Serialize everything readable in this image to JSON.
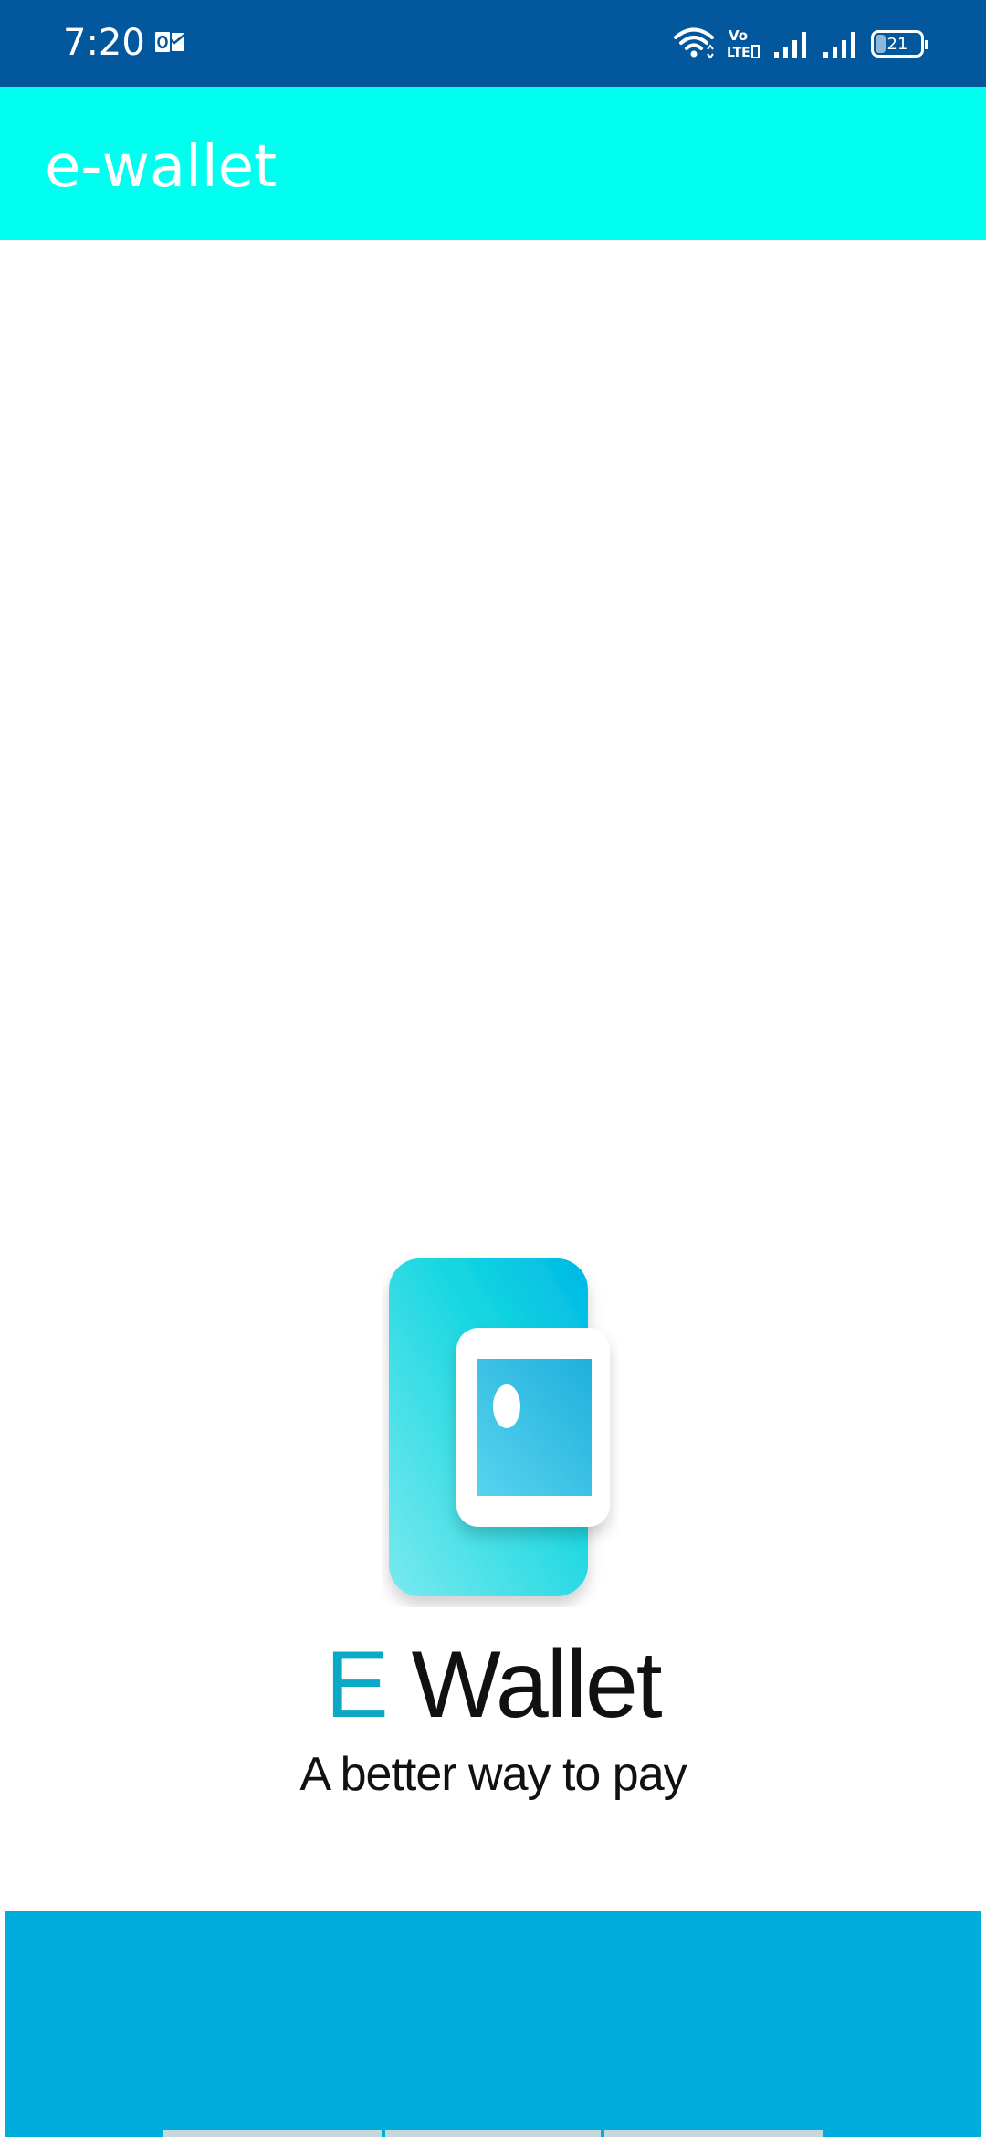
{
  "status_bar": {
    "time": "7:20",
    "battery": "21",
    "icons": [
      "outlook-notification-icon",
      "wifi-icon",
      "volte-icon",
      "signal-icon",
      "signal-icon",
      "battery-icon"
    ],
    "color": "#03589d"
  },
  "app_bar": {
    "title": "e-wallet",
    "color": "#00ffef"
  },
  "splash": {
    "logo_icon": "wallet-icon",
    "brand_prefix": "E",
    "brand_name": "Wallet",
    "tagline": "A better way to pay",
    "accent_color": "#0aa9c8"
  },
  "bottom_panel": {
    "color": "#00acdb"
  }
}
